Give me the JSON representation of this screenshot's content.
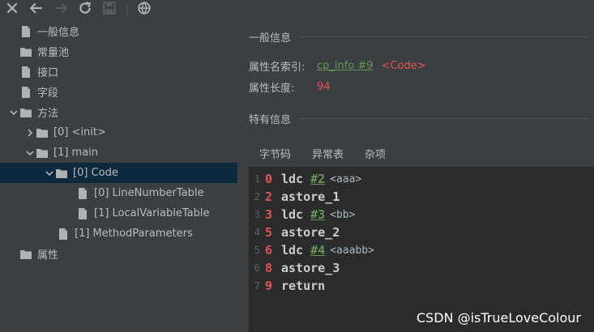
{
  "toolbar": {
    "buttons": [
      {
        "icon": "close-icon",
        "enabled": true
      },
      {
        "icon": "back-arrow-icon",
        "enabled": true
      },
      {
        "icon": "forward-arrow-icon",
        "enabled": false
      },
      {
        "icon": "refresh-icon",
        "enabled": true
      },
      {
        "icon": "save-icon",
        "enabled": false
      },
      {
        "icon": "globe-icon",
        "enabled": true
      }
    ]
  },
  "tree": {
    "items": [
      {
        "label": "一般信息",
        "icon": "file-icon",
        "arrow": "none"
      },
      {
        "label": "常量池",
        "icon": "folder-icon",
        "arrow": "none"
      },
      {
        "label": "接口",
        "icon": "file-icon",
        "arrow": "none"
      },
      {
        "label": "字段",
        "icon": "file-icon",
        "arrow": "none"
      },
      {
        "label": "方法",
        "icon": "folder-icon",
        "arrow": "expanded"
      },
      {
        "label": "[0] <init>",
        "icon": "folder-icon",
        "arrow": "collapsed"
      },
      {
        "label": "[1] main",
        "icon": "folder-icon",
        "arrow": "expanded"
      },
      {
        "label": "[0] Code",
        "icon": "folder-icon",
        "arrow": "expanded",
        "selected": true
      },
      {
        "label": "[0] LineNumberTable",
        "icon": "file-icon",
        "arrow": "none"
      },
      {
        "label": "[1] LocalVariableTable",
        "icon": "file-icon",
        "arrow": "none"
      },
      {
        "label": "[1] MethodParameters",
        "icon": "file-icon",
        "arrow": "none"
      },
      {
        "label": "属性",
        "icon": "folder-icon",
        "arrow": "none"
      }
    ]
  },
  "detail": {
    "general_title": "一般信息",
    "attr_name_label": "属性名索引:",
    "attr_name_link": "cp_info #9",
    "attr_name_value": "<Code>",
    "attr_length_label": "属性长度:",
    "attr_length_value": "94",
    "specific_title": "特有信息",
    "tabs": [
      "字节码",
      "异常表",
      "杂项"
    ]
  },
  "bytecode": [
    {
      "line": "1",
      "pc": "0",
      "op": "ldc",
      "ref": "#2",
      "comment": "<aaa>"
    },
    {
      "line": "2",
      "pc": "2",
      "op": "astore_1",
      "ref": "",
      "comment": ""
    },
    {
      "line": "3",
      "pc": "3",
      "op": "ldc",
      "ref": "#3",
      "comment": "<bb>"
    },
    {
      "line": "4",
      "pc": "5",
      "op": "astore_2",
      "ref": "",
      "comment": ""
    },
    {
      "line": "5",
      "pc": "6",
      "op": "ldc",
      "ref": "#4",
      "comment": "<aaabb>"
    },
    {
      "line": "6",
      "pc": "8",
      "op": "astore_3",
      "ref": "",
      "comment": ""
    },
    {
      "line": "7",
      "pc": "9",
      "op": "return",
      "ref": "",
      "comment": ""
    }
  ],
  "watermark": "CSDN @isTrueLoveColour",
  "colors": {
    "background": "#3c3f41",
    "code_background": "#2b2b2b",
    "selected_row": "#0d293e",
    "link_green": "#629755",
    "value_red": "#e05555"
  }
}
